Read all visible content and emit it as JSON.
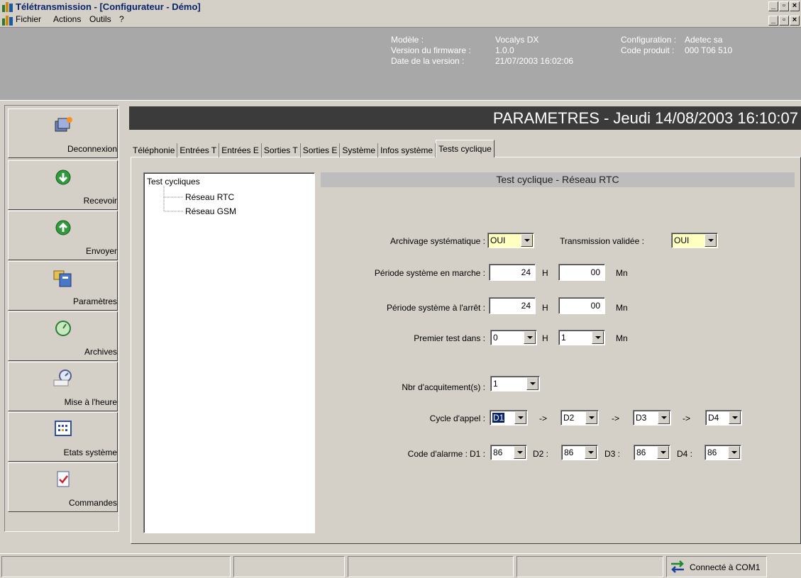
{
  "window": {
    "title": "Télétransmission - [Configurateur - Démo]",
    "menu": [
      "Fichier",
      "Actions",
      "Outils",
      "?"
    ]
  },
  "info": {
    "model_label": "Modèle :",
    "model_value": "Vocalys DX",
    "fw_label": "Version du firmware :",
    "fw_value": "1.0.0",
    "date_label": "Date de la version :",
    "date_value": "21/07/2003 16:02:06",
    "config_label": "Configuration :",
    "config_value": "Adetec sa",
    "code_label": "Code produit :",
    "code_value": "000 T06 510"
  },
  "sidebar": {
    "items": [
      {
        "label": "Deconnexion",
        "icon": "disconnect-icon"
      },
      {
        "label": "Recevoir",
        "icon": "download-icon"
      },
      {
        "label": "Envoyer",
        "icon": "upload-icon"
      },
      {
        "label": "Paramètres",
        "icon": "parameters-icon"
      },
      {
        "label": "Archives",
        "icon": "archives-icon"
      },
      {
        "label": "Mise à l'heure",
        "icon": "clock-icon"
      },
      {
        "label": "Etats système",
        "icon": "system-states-icon"
      },
      {
        "label": "Commandes",
        "icon": "commands-icon"
      }
    ]
  },
  "header": {
    "title": "PARAMETRES - Jeudi 14/08/2003 16:10:07"
  },
  "tabs": [
    "Téléphonie",
    "Entrées T",
    "Entrées E",
    "Sorties T",
    "Sorties E",
    "Système",
    "Infos système",
    "Tests cyclique"
  ],
  "tree": {
    "root": "Test cycliques",
    "children": [
      "Réseau RTC",
      "Réseau GSM"
    ]
  },
  "form": {
    "section_title": "Test cyclique - Réseau RTC",
    "archivage_label": "Archivage systématique :",
    "archivage_value": "OUI",
    "transmission_label": "Transmission validée :",
    "transmission_value": "OUI",
    "periode_marche_label": "Période système en marche :",
    "periode_marche_h": "24",
    "periode_marche_mn": "00",
    "periode_arret_label": "Période système à l'arrêt :",
    "periode_arret_h": "24",
    "periode_arret_mn": "00",
    "premier_test_label": "Premier test dans :",
    "premier_test_h": "0",
    "premier_test_mn": "1",
    "unit_h": "H",
    "unit_mn": "Mn",
    "nbr_acq_label": "Nbr d'acquitement(s) :",
    "nbr_acq_value": "1",
    "cycle_label": "Cycle d'appel :",
    "cycle_values": [
      "D1",
      "D2",
      "D3",
      "D4"
    ],
    "arrow": "->",
    "code_label": "Code d'alarme :",
    "code_slots": [
      "D1 :",
      "D2 :",
      "D3 :",
      "D4 :"
    ],
    "code_values": [
      "86",
      "86",
      "86",
      "86"
    ]
  },
  "status": {
    "connection": "Connecté à COM1"
  }
}
